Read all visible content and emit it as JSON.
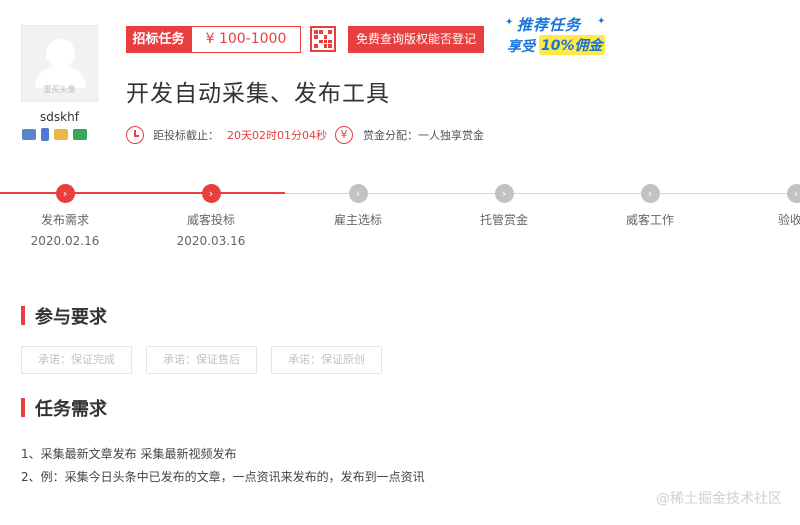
{
  "user": {
    "avatar_caption": "雷买头像",
    "name": "sdskhf"
  },
  "task": {
    "tag_label": "招标任务",
    "price": "¥ 100-1000",
    "copyright_button": "免费查询版权能否登记",
    "promo_line1": "推荐任务",
    "promo_line2a": "享受",
    "promo_pct": "10%",
    "promo_line2b": "佣金",
    "title": "开发自动采集、发布工具",
    "deadline_label": "距投标截止：",
    "countdown": "20天02时01分04秒",
    "reward_label": "赏金分配：",
    "reward_value": "一人独享赏金"
  },
  "steps": [
    {
      "label": "发布需求",
      "date": "2020.02.16",
      "active": true
    },
    {
      "label": "威客投标",
      "date": "2020.03.16",
      "active": true
    },
    {
      "label": "雇主选标",
      "date": "",
      "active": false
    },
    {
      "label": "托管赏金",
      "date": "",
      "active": false
    },
    {
      "label": "威客工作",
      "date": "",
      "active": false
    },
    {
      "label": "验收付",
      "date": "",
      "active": false
    }
  ],
  "sections": {
    "requirements_title": "参与要求",
    "pledges": [
      "承诺：保证完成",
      "承诺：保证售后",
      "承诺：保证原创"
    ],
    "needs_title": "任务需求",
    "needs": [
      "1、采集最新文章发布 采集最新视频发布",
      "2、例：采集今日头条中已发布的文章，一点资讯来发布的，发布到一点资讯"
    ]
  },
  "watermark": "@稀土掘金技术社区",
  "colors": {
    "accent": "#e83e3e",
    "promo_blue": "#1a73d9",
    "promo_yellow": "#ffe94a"
  }
}
